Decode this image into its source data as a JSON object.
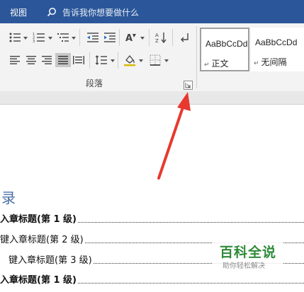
{
  "titlebar": {
    "tab_view": "视图",
    "tell_me_text": "告诉我你想要做什么",
    "icons": [
      "search-icon"
    ],
    "bg_color": "#2b579a"
  },
  "ribbon": {
    "paragraph_group_label": "段落",
    "launcher_icon": "dialog-launcher-icon",
    "styles": [
      {
        "sample": "AaBbCcDd",
        "name": "正文",
        "selected": true
      },
      {
        "sample": "AaBbCcDd",
        "name": "无间隔",
        "selected": false
      }
    ]
  },
  "document": {
    "toc_title": "录",
    "toc_lines": [
      {
        "text": "入章标题(第  1  级)",
        "bold": true
      },
      {
        "text": "键入章标题(第  2  级)",
        "bold": false
      },
      {
        "text": "键入章标题(第  3  级)",
        "bold": false
      },
      {
        "text": "入章标题(第  1  级)",
        "bold": true
      }
    ]
  },
  "watermark": {
    "title": "百科全说",
    "subtitle": "助你轻松解决"
  },
  "annotation": {
    "arrow_color": "#e8392f"
  }
}
